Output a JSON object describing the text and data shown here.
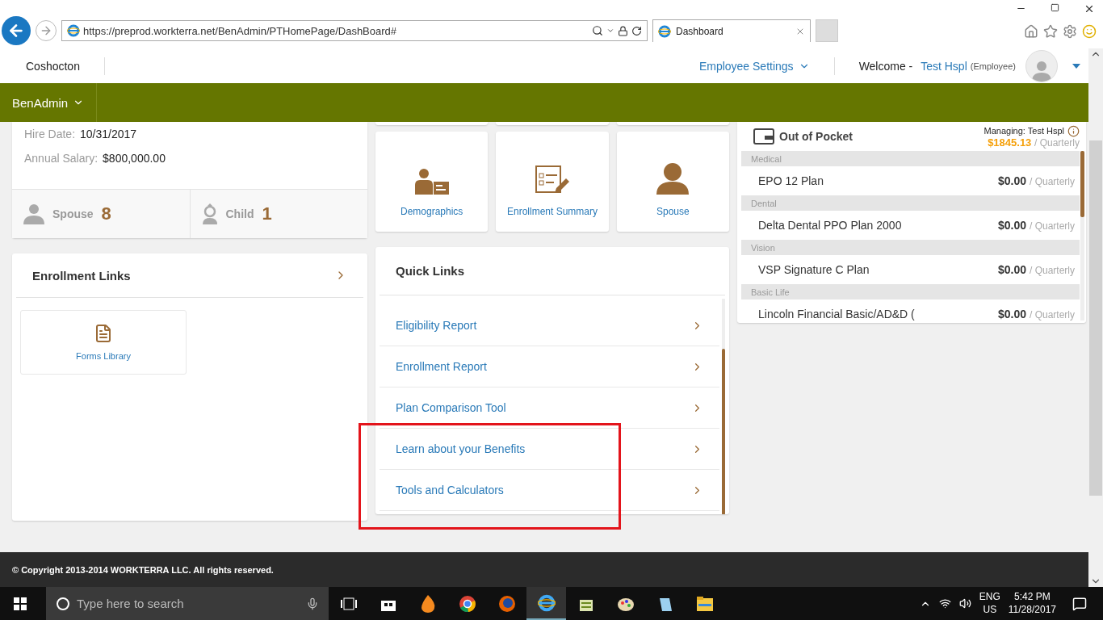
{
  "browser": {
    "url": "https://preprod.workterra.net/BenAdmin/PTHomePage/DashBoard#",
    "tab_title": "Dashboard"
  },
  "header": {
    "site": "Coshocton",
    "settings": "Employee Settings",
    "welcome": "Welcome -",
    "user": "Test Hspl",
    "role": "(Employee)"
  },
  "nav": {
    "menu": "BenAdmin"
  },
  "profile": {
    "fields": [
      {
        "label": "Hire Date:",
        "value": "10/31/2017"
      },
      {
        "label": "Annual Salary:",
        "value": "$800,000.00"
      }
    ],
    "dependents": [
      {
        "kind": "adult",
        "label": "Spouse",
        "count": "8"
      },
      {
        "kind": "child",
        "label": "Child",
        "count": "1"
      }
    ]
  },
  "tiles": [
    {
      "kind": "demographics",
      "label": "Demographics"
    },
    {
      "kind": "summary",
      "label": "Enrollment Summary"
    },
    {
      "kind": "person",
      "label": "Spouse"
    }
  ],
  "enrollment_links": {
    "title": "Enrollment Links",
    "items": [
      {
        "label": "Forms Library"
      }
    ]
  },
  "quick_links": {
    "title": "Quick Links",
    "items": [
      {
        "label": "Eligibility Report"
      },
      {
        "label": "Enrollment Report"
      },
      {
        "label": "Plan Comparison Tool"
      },
      {
        "label": "Learn about your Benefits"
      },
      {
        "label": "Tools and Calculators"
      }
    ]
  },
  "out_of_pocket": {
    "title": "Out of Pocket",
    "managing": "Managing: Test Hspl",
    "total": "$1845.13",
    "total_period": "/ Quarterly",
    "groups": [
      {
        "name": "Medical",
        "plan": "EPO 12 Plan",
        "amount": "$0.00",
        "period": "/ Quarterly"
      },
      {
        "name": "Dental",
        "plan": "Delta Dental PPO Plan 2000",
        "amount": "$0.00",
        "period": "/ Quarterly"
      },
      {
        "name": "Vision",
        "plan": "VSP Signature C Plan",
        "amount": "$0.00",
        "period": "/ Quarterly"
      },
      {
        "name": "Basic Life",
        "plan": "Lincoln Financial Basic/AD&D (",
        "amount": "$0.00",
        "period": "/ Quarterly"
      }
    ]
  },
  "footer": "© Copyright 2013-2014 WORKTERRA LLC. All rights reserved.",
  "taskbar": {
    "search_placeholder": "Type here to search",
    "lang": "ENG",
    "region": "US",
    "time": "5:42 PM",
    "date": "11/28/2017"
  }
}
